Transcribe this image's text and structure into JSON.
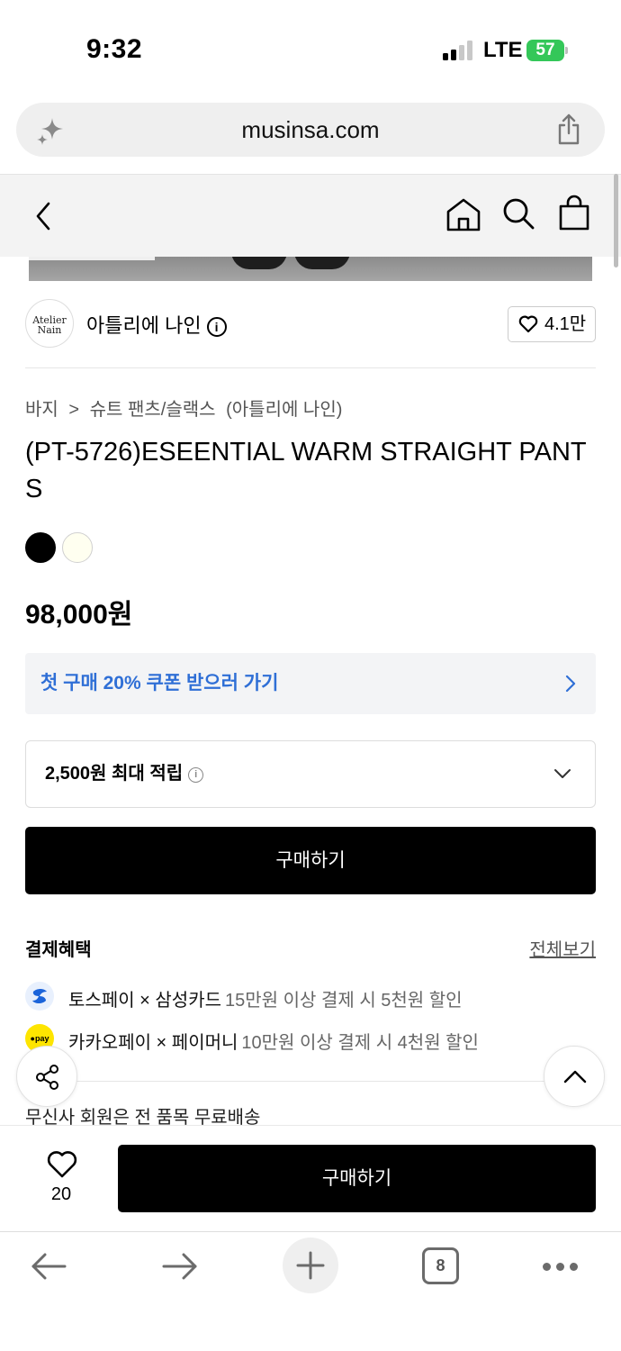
{
  "status_bar": {
    "time": "9:32",
    "network": "LTE",
    "battery": "57"
  },
  "browser": {
    "url": "musinsa.com"
  },
  "brand": {
    "logo_text_line1": "Atelier",
    "logo_text_line2": "Nain",
    "name": "아틀리에 나인",
    "likes": "4.1만"
  },
  "breadcrumb": {
    "category": "바지",
    "separator": ">",
    "subcategory": "슈트 팬츠/슬랙스",
    "brand": "(아틀리에 나인)"
  },
  "product": {
    "title": "(PT-5726)ESEENTIAL WARM STRAIGHT PANTS",
    "colors": [
      "#000000",
      "#fffff0"
    ],
    "price": "98,000원"
  },
  "coupon": {
    "label": "첫 구매 20% 쿠폰 받으러 가기"
  },
  "points": {
    "label": "2,500원 최대 적립"
  },
  "buy_label": "구매하기",
  "payment_benefits": {
    "title": "결제혜택",
    "view_all": "전체보기",
    "items": [
      {
        "provider": "토스페이 × 삼성카드",
        "detail": "15만원 이상 결제 시 5천원 할인"
      },
      {
        "provider": "카카오페이 × 페이머니",
        "detail": "10만원 이상 결제 시 4천원 할인",
        "icon_text": "pay"
      }
    ]
  },
  "shipping": {
    "text": "무신사 회원은 전 품목 무료배송"
  },
  "bottom_bar": {
    "wish_count": "20",
    "buy_label": "구매하기"
  },
  "toolbar": {
    "tab_count": "8"
  }
}
